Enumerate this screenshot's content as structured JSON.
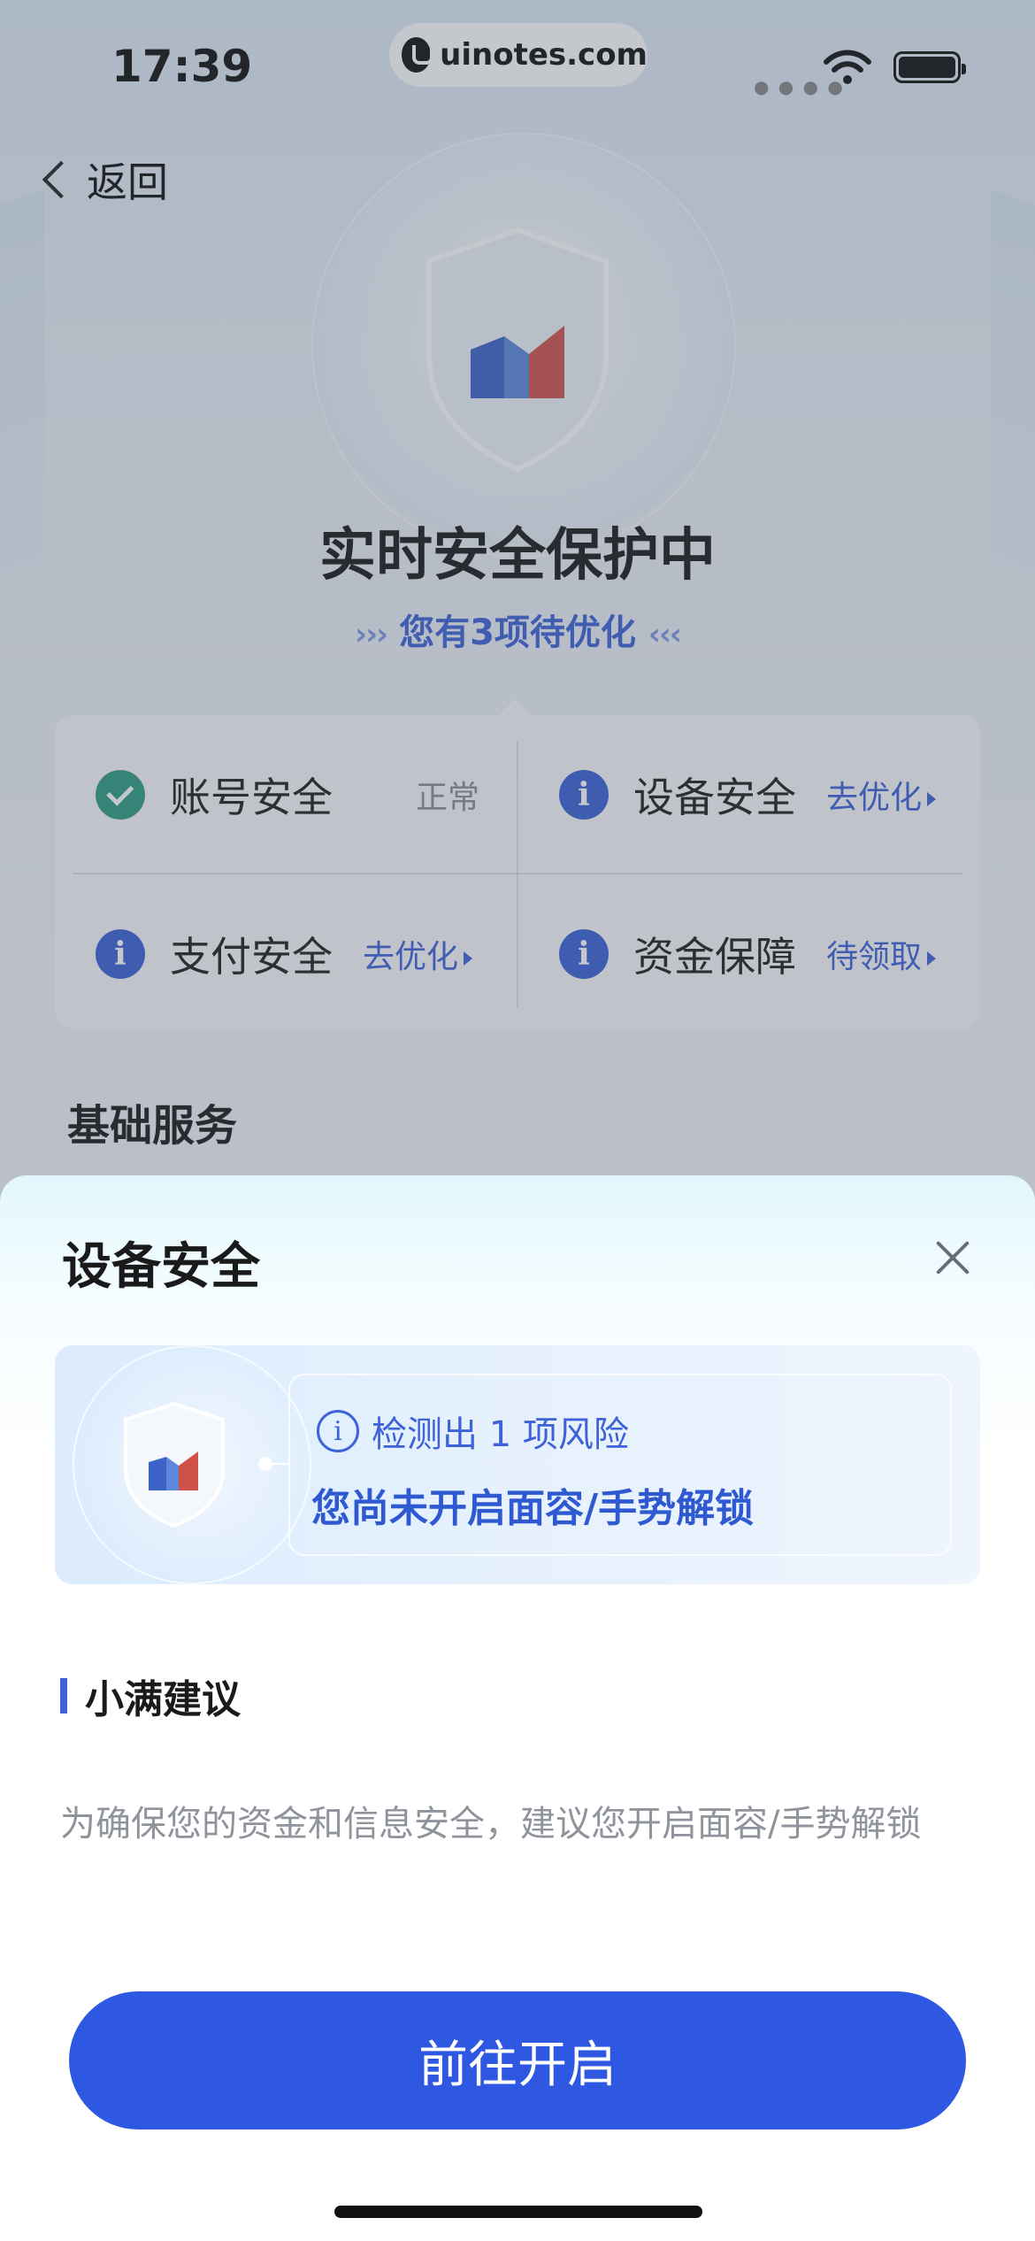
{
  "status_bar": {
    "time": "17:39",
    "site_badge": "uinotes.com"
  },
  "nav": {
    "back_label": "返回"
  },
  "hero": {
    "title": "实时安全保护中",
    "subtitle": "您有3项待优化",
    "arrows_left": "›››",
    "arrows_right": "‹‹‹"
  },
  "security_items": [
    {
      "label": "账号安全",
      "status": "正常",
      "icon": "check-icon",
      "action": ""
    },
    {
      "label": "设备安全",
      "status": "",
      "icon": "info-icon",
      "action": "去优化"
    },
    {
      "label": "支付安全",
      "status": "",
      "icon": "info-icon",
      "action": "去优化"
    },
    {
      "label": "资金保障",
      "status": "",
      "icon": "info-icon",
      "action": "待领取"
    }
  ],
  "basic_services": {
    "title": "基础服务"
  },
  "sheet": {
    "title": "设备安全",
    "risk_count_text": "检测出 1 项风险",
    "risk_detail": "您尚未开启面容/手势解锁",
    "suggestion_title": "小满建议",
    "suggestion_text": "为确保您的资金和信息安全，建议您开启面容/手势解锁",
    "cta_label": "前往开启"
  },
  "colors": {
    "accent": "#2f58e2",
    "link": "#3e63d8",
    "ok_green": "#2e9c84"
  }
}
